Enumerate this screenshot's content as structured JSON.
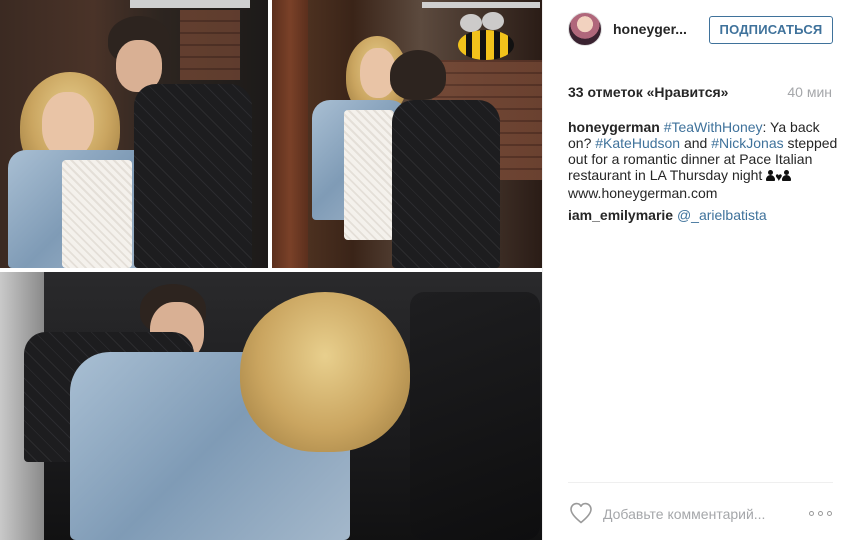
{
  "post": {
    "username": "honeyger...",
    "follow_label": "ПОДПИСАТЬСЯ",
    "likes": "33 отметок «Нравится»",
    "time_ago": "40 мин",
    "caption": {
      "author": "honeygerman",
      "hashtag_1": "#TeaWithHoney",
      "text_1": ": Ya back on? ",
      "hashtag_2": "#KateHudson",
      "text_2": " and ",
      "hashtag_3": "#NickJonas",
      "text_3": " stepped out for a romantic dinner at Pace Italian restaurant in LA Thursday night ",
      "text_4": " www.honeygerman.com"
    },
    "comments": [
      {
        "user": "iam_emilymarie",
        "mention": "@_arielbatista"
      }
    ]
  },
  "footer": {
    "comment_placeholder": "Добавьте комментарий..."
  },
  "colors": {
    "link_blue": "#3f729b",
    "text_dark": "#262626",
    "text_muted": "#a5a7aa"
  },
  "icons": [
    "heart-icon",
    "more-options-icon"
  ]
}
